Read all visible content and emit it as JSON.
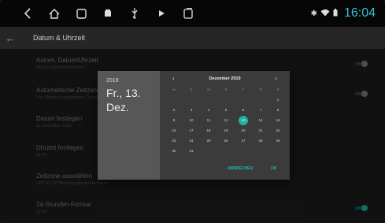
{
  "status": {
    "time": "16:04"
  },
  "header": {
    "title": "Datum & Uhrzeit"
  },
  "settings": [
    {
      "title": "Autom. Datum/Uhrzeit",
      "subtitle": "Zeit aus Netzwerk beziehen",
      "toggle": "off"
    },
    {
      "title": "Automatische Zeitzone",
      "subtitle": "Vom Netzwerk angegebene Zeitzone",
      "toggle": "off"
    },
    {
      "title": "Datum festlegen",
      "subtitle": "13. Dezember 2019",
      "toggle": null
    },
    {
      "title": "Uhrzeit festlegen",
      "subtitle": "16:04",
      "toggle": null
    },
    {
      "title": "Zeitzone auswählen",
      "subtitle": "GMT+01:00 Mitteleuropäische Normalzeit",
      "toggle": null
    },
    {
      "title": "24-Stunden-Format",
      "subtitle": "13:00",
      "toggle": "on"
    }
  ],
  "dialog": {
    "year": "2019",
    "date": "Fr., 13. Dez.",
    "month_label": "Dezember 2019",
    "prev": "‹",
    "next": "›",
    "weekdays": [
      "M",
      "D",
      "M",
      "D",
      "F",
      "S",
      "S"
    ],
    "first_weekday_index": 6,
    "days_in_month": 31,
    "selected_day": 13,
    "cancel": "ABBRECHEN",
    "ok": "OK"
  },
  "colors": {
    "accent": "#1ab2a4",
    "time": "#38c0d2"
  }
}
